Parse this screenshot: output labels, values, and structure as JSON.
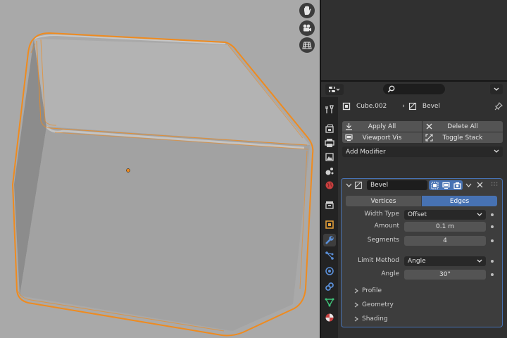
{
  "viewport": {
    "nav_icons": [
      "hand-icon",
      "camera-icon",
      "grid-icon"
    ],
    "colors": {
      "background": "#a9a9a9",
      "selection_outline": "#ef8b1f",
      "origin_dot": "#ef8b1f"
    }
  },
  "properties": {
    "header": {
      "editor_icon": "properties-editor-icon",
      "search_placeholder": ""
    },
    "tabs": [
      "tool-icon",
      "render-icon",
      "output-icon",
      "view-layer-icon",
      "scene-icon",
      "world-icon",
      "collection-icon",
      "object-icon",
      "modifier-icon",
      "particles-icon",
      "physics-icon",
      "constraints-icon",
      "object-data-icon",
      "material-icon"
    ],
    "active_tab": "modifier-icon",
    "breadcrumb": {
      "object": "Cube.002",
      "separator": "›",
      "modifier": "Bevel"
    },
    "buttons": {
      "apply_all": "Apply All",
      "delete_all": "Delete All",
      "viewport_vis": "Viewport Vis",
      "toggle_stack": "Toggle Stack"
    },
    "add_modifier": "Add Modifier",
    "modifier": {
      "name": "Bevel",
      "affect_options": [
        "Vertices",
        "Edges"
      ],
      "affect_selected": "Edges",
      "width_type_label": "Width Type",
      "width_type_value": "Offset",
      "amount_label": "Amount",
      "amount_value": "0.1 m",
      "segments_label": "Segments",
      "segments_value": "4",
      "limit_method_label": "Limit Method",
      "limit_method_value": "Angle",
      "angle_label": "Angle",
      "angle_value": "30°",
      "subpanels": [
        "Profile",
        "Geometry",
        "Shading"
      ]
    },
    "colors": {
      "accent": "#4772b3",
      "panel": "#3d3d3d",
      "button": "#545454"
    }
  }
}
